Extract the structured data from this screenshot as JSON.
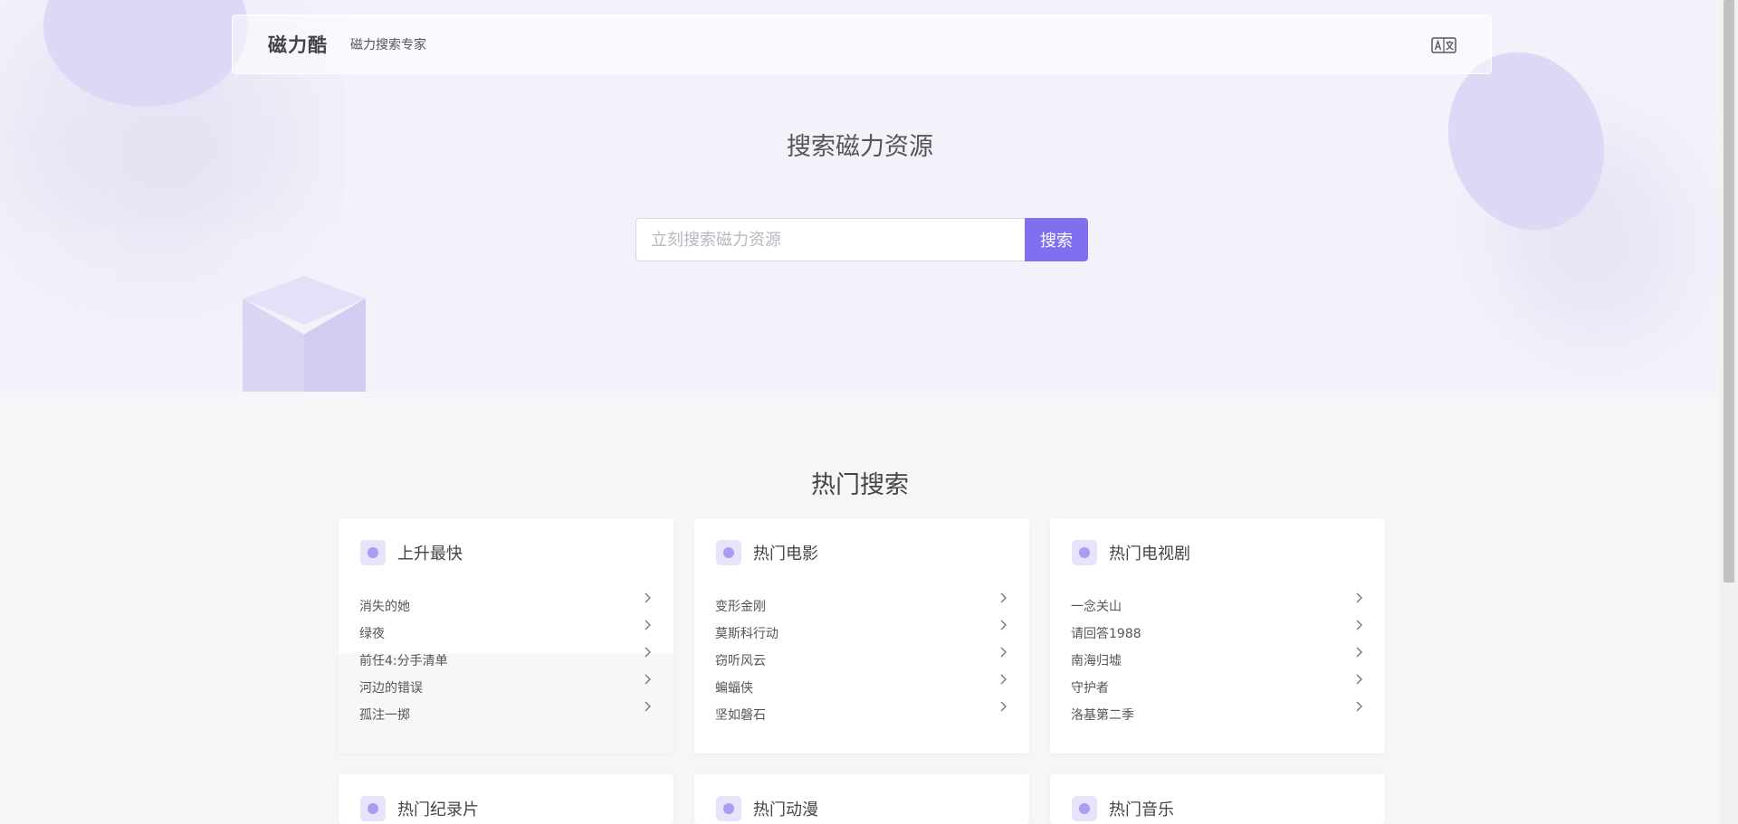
{
  "header": {
    "brand": "磁力酷",
    "tagline": "磁力搜索专家",
    "lang_icon": "translate-icon"
  },
  "hero": {
    "title": "搜索磁力资源",
    "search_placeholder": "立刻搜索磁力资源",
    "search_value": "",
    "search_button": "搜索"
  },
  "hot": {
    "title": "热门搜索",
    "cards": [
      {
        "title": "上升最快",
        "items": [
          "消失的她",
          "绿夜",
          "前任4:分手清单",
          "河边的错误",
          "孤注一掷"
        ]
      },
      {
        "title": "热门电影",
        "items": [
          "变形金刚",
          "莫斯科行动",
          "窃听风云",
          "蝙蝠侠",
          "坚如磐石"
        ]
      },
      {
        "title": "热门电视剧",
        "items": [
          "一念关山",
          "请回答1988",
          "南海归墟",
          "守护者",
          "洛基第二季"
        ]
      },
      {
        "title": "热门纪录片",
        "items": []
      },
      {
        "title": "热门动漫",
        "items": []
      },
      {
        "title": "热门音乐",
        "items": []
      }
    ]
  },
  "colors": {
    "accent": "#7e70ef",
    "hero_bg": "#f3f1fa",
    "page_bg": "#f6f6f9"
  }
}
